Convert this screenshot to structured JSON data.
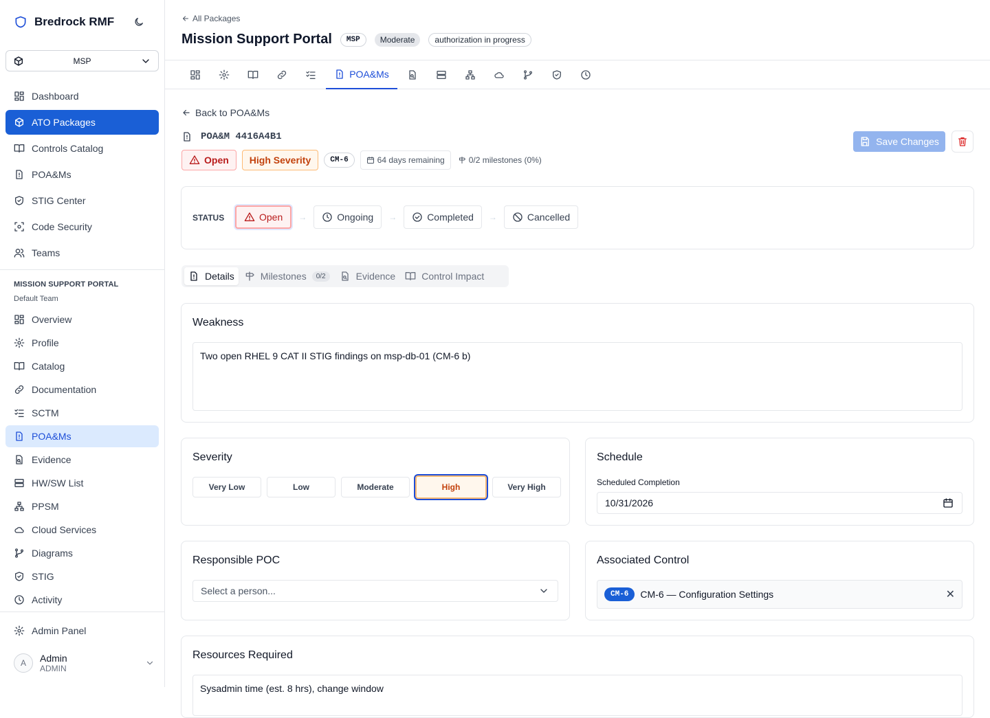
{
  "app": {
    "name": "Bredrock RMF"
  },
  "sidebar": {
    "package_selector": "MSP",
    "main_nav": [
      {
        "label": "Dashboard"
      },
      {
        "label": "ATO Packages"
      },
      {
        "label": "Controls Catalog"
      },
      {
        "label": "POA&Ms"
      },
      {
        "label": "STIG Center"
      },
      {
        "label": "Code Security"
      },
      {
        "label": "Teams"
      }
    ],
    "section_title": "MISSION SUPPORT PORTAL",
    "section_subtitle": "Default Team",
    "package_nav": [
      {
        "label": "Overview"
      },
      {
        "label": "Profile"
      },
      {
        "label": "Catalog"
      },
      {
        "label": "Documentation"
      },
      {
        "label": "SCTM"
      },
      {
        "label": "POA&Ms"
      },
      {
        "label": "Evidence"
      },
      {
        "label": "HW/SW List"
      },
      {
        "label": "PPSM"
      },
      {
        "label": "Cloud Services"
      },
      {
        "label": "Diagrams"
      },
      {
        "label": "STIG"
      },
      {
        "label": "Activity"
      }
    ],
    "admin_panel": "Admin Panel",
    "user": {
      "initial": "A",
      "name": "Admin",
      "role": "ADMIN"
    }
  },
  "header": {
    "back_link": "All Packages",
    "title": "Mission Support Portal",
    "badges": {
      "code": "MSP",
      "impact": "Moderate",
      "status": "authorization in progress"
    },
    "active_tab": "POA&Ms"
  },
  "poam": {
    "back_link": "Back to POA&Ms",
    "id": "POA&M 4416A4B1",
    "status_badge": "Open",
    "severity_badge": "High Severity",
    "control_badge": "CM-6",
    "days_remaining": "64 days remaining",
    "milestones_progress": "0/2 milestones (0%)",
    "save_label": "Save Changes",
    "status_label": "STATUS",
    "statuses": [
      "Open",
      "Ongoing",
      "Completed",
      "Cancelled"
    ],
    "current_status": "Open",
    "subtabs": [
      "Details",
      "Milestones",
      "Evidence",
      "Control Impact"
    ],
    "milestones_count": "0/2",
    "weakness_title": "Weakness",
    "weakness_text": "Two open RHEL 9 CAT II STIG findings on msp-db-01 (CM-6 b)",
    "severity_title": "Severity",
    "severities": [
      "Very Low",
      "Low",
      "Moderate",
      "High",
      "Very High"
    ],
    "current_severity": "High",
    "schedule_title": "Schedule",
    "scheduled_label": "Scheduled Completion",
    "scheduled_date": "10/31/2026",
    "poc_title": "Responsible POC",
    "poc_placeholder": "Select a person...",
    "assoc_title": "Associated Control",
    "assoc_pill": "CM-6",
    "assoc_text": "CM-6 — Configuration Settings",
    "resources_title": "Resources Required",
    "resources_text": "Sysadmin time (est. 8 hrs), change window"
  },
  "colors": {
    "accent": "#1a5fd6",
    "danger": "#b91c1c",
    "warning": "#c2410c"
  }
}
